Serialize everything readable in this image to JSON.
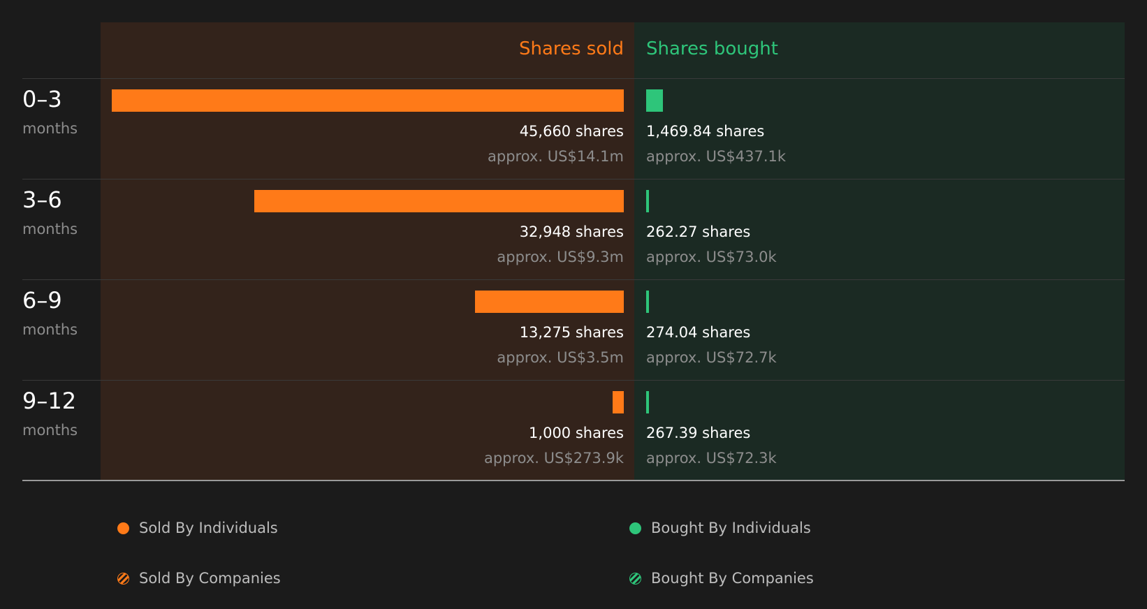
{
  "colors": {
    "sold": "#ff7a18",
    "bought": "#2ec57a",
    "background": "#1b1b1b",
    "sold_panel": "#33231b",
    "bought_panel": "#1b2a23"
  },
  "chart_data": {
    "type": "bar",
    "orientation": "horizontal-diverging",
    "columns": {
      "sold": "Shares sold",
      "bought": "Shares bought"
    },
    "categories": [
      {
        "range": "0–3",
        "unit": "months"
      },
      {
        "range": "3–6",
        "unit": "months"
      },
      {
        "range": "6–9",
        "unit": "months"
      },
      {
        "range": "9–12",
        "unit": "months"
      }
    ],
    "series": [
      {
        "name": "Shares sold",
        "values": [
          45660,
          32948,
          13275,
          1000
        ],
        "labels": [
          "45,660 shares",
          "32,948 shares",
          "13,275 shares",
          "1,000 shares"
        ],
        "value_labels": [
          "approx. US$14.1m",
          "approx. US$9.3m",
          "approx. US$3.5m",
          "approx. US$273.9k"
        ]
      },
      {
        "name": "Shares bought",
        "values": [
          1469.84,
          262.27,
          274.04,
          267.39
        ],
        "labels": [
          "1,469.84 shares",
          "262.27 shares",
          "274.04 shares",
          "267.39 shares"
        ],
        "value_labels": [
          "approx. US$437.1k",
          "approx. US$73.0k",
          "approx. US$72.7k",
          "approx. US$72.3k"
        ]
      }
    ],
    "xlim": [
      0,
      45660
    ],
    "legend": {
      "placement": "bottom",
      "items": [
        {
          "label": "Sold By Individuals",
          "style": "solid",
          "color": "#ff7a18"
        },
        {
          "label": "Bought By Individuals",
          "style": "solid",
          "color": "#2ec57a"
        },
        {
          "label": "Sold By Companies",
          "style": "hatched",
          "color": "#ff7a18"
        },
        {
          "label": "Bought By Companies",
          "style": "hatched",
          "color": "#2ec57a"
        }
      ]
    }
  }
}
